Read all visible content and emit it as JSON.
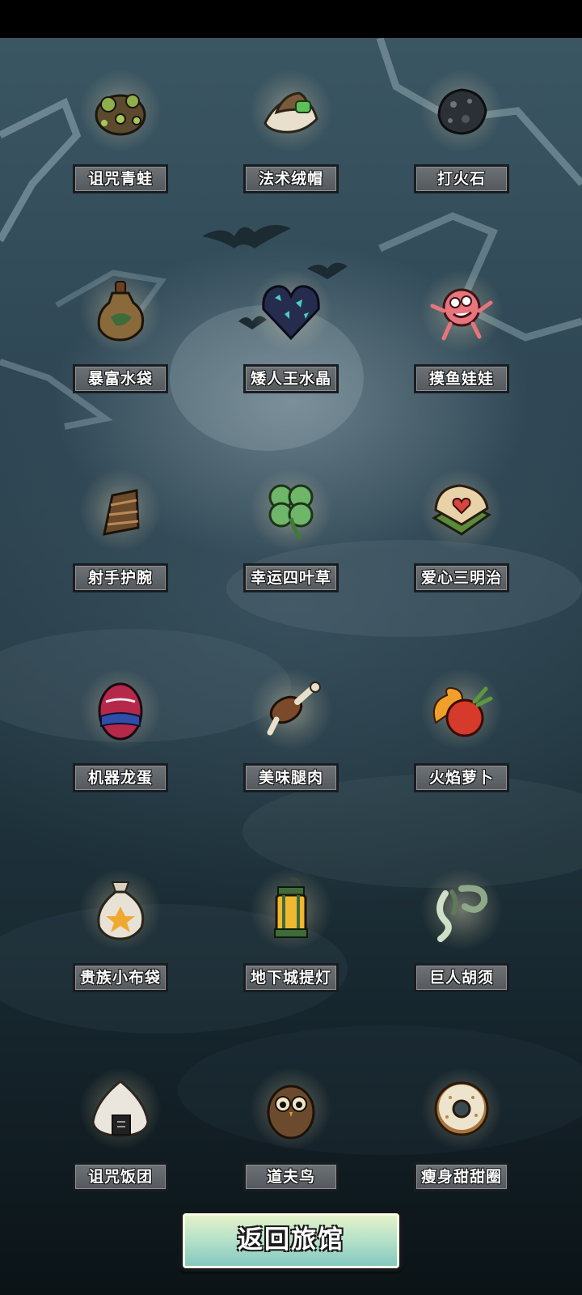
{
  "screen": "items-collection",
  "items": [
    {
      "label": "诅咒青蛙",
      "icon": "cursed-frog-icon"
    },
    {
      "label": "法术绒帽",
      "icon": "spell-fur-hat-icon"
    },
    {
      "label": "打火石",
      "icon": "flint-stone-icon"
    },
    {
      "label": "暴富水袋",
      "icon": "wealth-water-bag-icon"
    },
    {
      "label": "矮人王水晶",
      "icon": "dwarf-king-crystal-icon"
    },
    {
      "label": "摸鱼娃娃",
      "icon": "slacker-doll-icon"
    },
    {
      "label": "射手护腕",
      "icon": "archer-bracer-icon"
    },
    {
      "label": "幸运四叶草",
      "icon": "lucky-clover-icon"
    },
    {
      "label": "爱心三明治",
      "icon": "heart-sandwich-icon"
    },
    {
      "label": "机器龙蛋",
      "icon": "mech-dragon-egg-icon"
    },
    {
      "label": "美味腿肉",
      "icon": "tasty-drumstick-icon"
    },
    {
      "label": "火焰萝卜",
      "icon": "flame-radish-icon"
    },
    {
      "label": "贵族小布袋",
      "icon": "noble-pouch-icon"
    },
    {
      "label": "地下城提灯",
      "icon": "dungeon-lantern-icon"
    },
    {
      "label": "巨人胡须",
      "icon": "giant-beard-icon"
    },
    {
      "label": "诅咒饭团",
      "icon": "cursed-rice-ball-icon"
    },
    {
      "label": "道夫鸟",
      "icon": "dauf-bird-icon"
    },
    {
      "label": "瘦身甜甜圈",
      "icon": "slim-donut-icon"
    }
  ],
  "back_button": {
    "label": "返回旅馆"
  }
}
